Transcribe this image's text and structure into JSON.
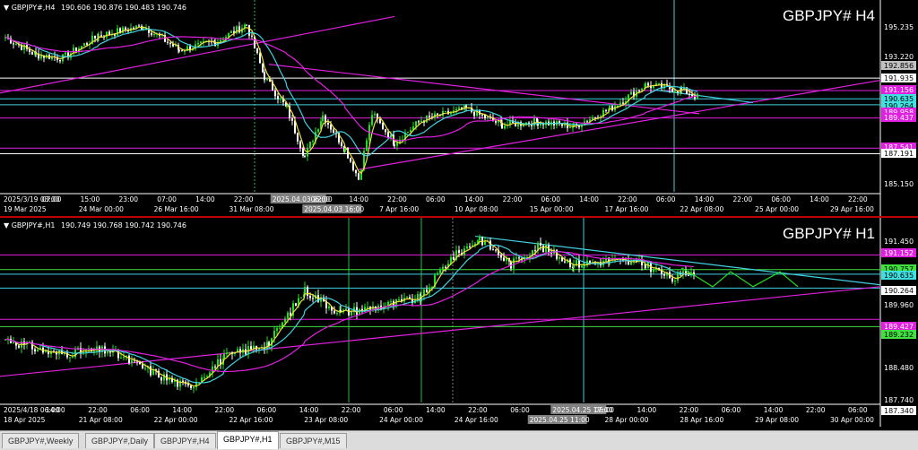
{
  "h4": {
    "header_symbol": "▼ GBPJPY#,H4",
    "header_ohlc": "190.606 190.876 190.483 190.746",
    "big_label": "GBPJPY# H4",
    "prices": [
      {
        "text": "195.235",
        "color": "#ffffff",
        "bg": ""
      },
      {
        "text": "193.220",
        "color": "#ffffff",
        "bg": ""
      },
      {
        "text": "192.856",
        "color": "#000000",
        "bg": "#c0c0c0"
      },
      {
        "text": "191.935",
        "color": "#000000",
        "bg": "#ffffff"
      },
      {
        "text": "191.156",
        "color": "#ffffff",
        "bg": "#e020e0"
      },
      {
        "text": "190.635",
        "color": "#000000",
        "bg": "#40e0e0"
      },
      {
        "text": "190.264",
        "color": "#000000",
        "bg": "#40e0e0"
      },
      {
        "text": "189.958",
        "color": "#ffffff",
        "bg": "#e020e0"
      },
      {
        "text": "189.437",
        "color": "#ffffff",
        "bg": "#e020e0"
      },
      {
        "text": "187.541",
        "color": "#ffffff",
        "bg": "#e020e0"
      },
      {
        "text": "187.191",
        "color": "#000000",
        "bg": "#ffffff"
      },
      {
        "text": "185.150",
        "color": "#ffffff",
        "bg": ""
      }
    ],
    "time_top": [
      "2025/3/19 03:00",
      "07:00",
      "15:00",
      "23:00",
      "07:00",
      "14:00",
      "22:00",
      "2025.04.03 22:00",
      "06:00",
      "14:00",
      "22:00",
      "06:00",
      "14:00",
      "22:00",
      "06:00",
      "14:00",
      "22:00",
      "06:00",
      "14:00",
      "22:00",
      "06:00",
      "14:00",
      "22:00"
    ],
    "time_bottom": [
      "19 Mar 2025",
      "24 Mar 00:00",
      "26 Mar 16:00",
      "31 Mar 08:00",
      "2025.04.03 16:00",
      "7 Apr 16:00",
      "10 Apr 08:00",
      "15 Apr 00:00",
      "17 Apr 16:00",
      "22 Apr 08:00",
      "25 Apr 00:00",
      "29 Apr 16:00"
    ]
  },
  "h1": {
    "header_symbol": "▼ GBPJPY#,H1",
    "header_ohlc": "190.749 190.768 190.742 190.746",
    "big_label": "GBPJPY# H1",
    "prices": [
      {
        "text": "191.450",
        "color": "#ffffff",
        "bg": ""
      },
      {
        "text": "191.152",
        "color": "#ffffff",
        "bg": "#e020e0"
      },
      {
        "text": "190.757",
        "color": "#000000",
        "bg": "#40e040"
      },
      {
        "text": "190.635",
        "color": "#000000",
        "bg": "#40e0e0"
      },
      {
        "text": "190.264",
        "color": "#000000",
        "bg": "#ffffff"
      },
      {
        "text": "189.960",
        "color": "#ffffff",
        "bg": ""
      },
      {
        "text": "189.427",
        "color": "#ffffff",
        "bg": "#e020e0"
      },
      {
        "text": "189.232",
        "color": "#000000",
        "bg": "#40e040"
      },
      {
        "text": "188.480",
        "color": "#ffffff",
        "bg": ""
      },
      {
        "text": "187.740",
        "color": "#ffffff",
        "bg": ""
      },
      {
        "text": "187.340",
        "color": "#000000",
        "bg": "#ffffff"
      }
    ],
    "time_top": [
      "2025/4/18 06:00",
      "14:00",
      "22:00",
      "06:00",
      "14:00",
      "22:00",
      "06:00",
      "14:00",
      "22:00",
      "06:00",
      "14:00",
      "22:00",
      "06:00",
      "2025.04.25 17:00",
      "06:00",
      "14:00",
      "22:00",
      "06:00",
      "14:00",
      "22:00",
      "06:00"
    ],
    "time_bottom": [
      "18 Apr 2025",
      "21 Apr 08:00",
      "22 Apr 00:00",
      "22 Apr 16:00",
      "23 Apr 08:00",
      "24 Apr 00:00",
      "24 Apr 16:00",
      "2025.04.25 11:00",
      "28 Apr 00:00",
      "28 Apr 16:00",
      "29 Apr 08:00",
      "30 Apr 00:00"
    ]
  },
  "tabs": [
    {
      "label": "GBPJPY#,Weekly",
      "active": false
    },
    {
      "label": "GBPJPY#,Daily",
      "active": false
    },
    {
      "label": "GBPJPY#,H4",
      "active": false
    },
    {
      "label": "GBPJPY#,H1",
      "active": true
    },
    {
      "label": "GBPJPY#,M15",
      "active": false
    }
  ],
  "colors": {
    "magenta": "#e020e0",
    "cyan": "#40d0e0",
    "yellow": "#f0e040",
    "green": "#20e020",
    "white": "#ffffff"
  }
}
